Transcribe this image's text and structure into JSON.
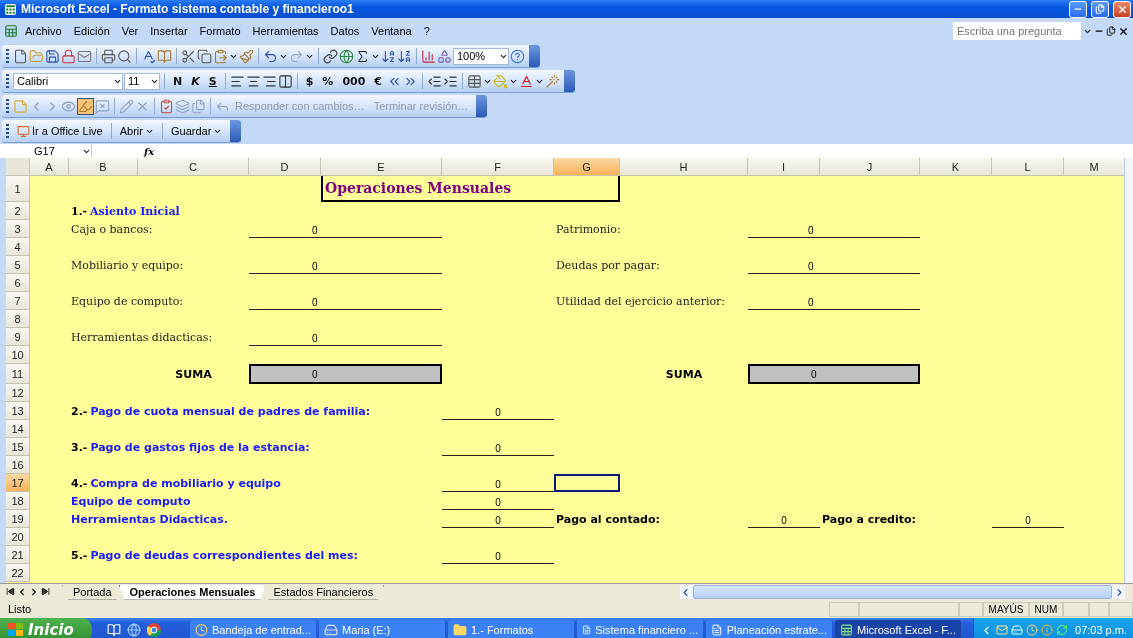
{
  "window": {
    "title": "Microsoft Excel - Formato sistema contable y financieroo1"
  },
  "menu": {
    "items": [
      "Archivo",
      "Edición",
      "Ver",
      "Insertar",
      "Formato",
      "Herramientas",
      "Datos",
      "Ventana",
      "?"
    ],
    "help_field": {
      "placeholder": "Escriba una pregunta"
    }
  },
  "standard_toolbar": {
    "zoom": "100%"
  },
  "format_toolbar": {
    "font": "Calibri",
    "size": "11",
    "style_buttons": [
      "N",
      "K",
      "S"
    ],
    "number_buttons": [
      "$",
      "%",
      "000",
      "€"
    ]
  },
  "review_toolbar": {
    "items": [
      {
        "label": "Responder con cambios…",
        "disabled": true
      },
      {
        "label": "Terminar revisión…",
        "disabled": true
      }
    ]
  },
  "office_live_toolbar": {
    "buttons": [
      {
        "label": "Ir a Office Live",
        "dropdown": false
      },
      {
        "label": "Abrir",
        "dropdown": true
      },
      {
        "label": "Guardar",
        "dropdown": true
      }
    ]
  },
  "formula_bar": {
    "name_box": "G17",
    "function_label": "fx"
  },
  "columns": [
    {
      "label": "A",
      "selected": false
    },
    {
      "label": "B",
      "selected": false
    },
    {
      "label": "C",
      "selected": false
    },
    {
      "label": "D",
      "selected": false
    },
    {
      "label": "E",
      "selected": false
    },
    {
      "label": "F",
      "selected": false
    },
    {
      "label": "G",
      "selected": true
    },
    {
      "label": "H",
      "selected": false
    },
    {
      "label": "I",
      "selected": false
    },
    {
      "label": "J",
      "selected": false
    },
    {
      "label": "K",
      "selected": false
    },
    {
      "label": "L",
      "selected": false
    },
    {
      "label": "M",
      "selected": false
    }
  ],
  "rows": [
    {
      "number": "1",
      "selected": false,
      "cells": [
        {
          "kind": "title",
          "text": "Operaciones Mensuales"
        }
      ]
    },
    {
      "number": "2",
      "selected": false,
      "cells": [
        {
          "kind": "serif-section",
          "prefix": "1.-",
          "text": "Asiento Inicial"
        }
      ]
    },
    {
      "number": "3",
      "selected": false,
      "cells": [
        {
          "kind": "label",
          "text": "Caja o bancos:"
        },
        {
          "kind": "amount",
          "text": "0"
        },
        {
          "kind": "right-label",
          "text": "Patrimonio:"
        },
        {
          "kind": "right-amount",
          "text": "0"
        }
      ]
    },
    {
      "number": "4",
      "selected": false
    },
    {
      "number": "5",
      "selected": false,
      "cells": [
        {
          "kind": "label",
          "text": "Mobiliario y equipo:"
        },
        {
          "kind": "amount",
          "text": "0"
        },
        {
          "kind": "right-label",
          "text": "Deudas por pagar:"
        },
        {
          "kind": "right-amount",
          "text": "0"
        }
      ]
    },
    {
      "number": "6",
      "selected": false
    },
    {
      "number": "7",
      "selected": false,
      "cells": [
        {
          "kind": "label",
          "text": "Equipo de computo:"
        },
        {
          "kind": "amount",
          "text": "0"
        },
        {
          "kind": "right-label",
          "text": "Utilidad del ejercicio anterior:"
        },
        {
          "kind": "right-amount",
          "text": "0"
        }
      ]
    },
    {
      "number": "8",
      "selected": false
    },
    {
      "number": "9",
      "selected": false,
      "cells": [
        {
          "kind": "label",
          "text": "Herramientas didacticas:"
        },
        {
          "kind": "amount",
          "text": "0"
        }
      ]
    },
    {
      "number": "10",
      "selected": false
    },
    {
      "number": "11",
      "selected": false,
      "cells": [
        {
          "kind": "sum-label",
          "text": "SUMA"
        },
        {
          "kind": "sum-amount",
          "text": "0"
        },
        {
          "kind": "right-sum-label",
          "text": "SUMA"
        },
        {
          "kind": "right-sum-amount",
          "text": "0"
        }
      ]
    },
    {
      "number": "12",
      "selected": false
    },
    {
      "number": "13",
      "selected": false,
      "cells": [
        {
          "kind": "section",
          "prefix": "2.-",
          "text": "Pago de cuota mensual de padres de familia:"
        },
        {
          "kind": "f-amount",
          "text": "0"
        }
      ]
    },
    {
      "number": "14",
      "selected": false
    },
    {
      "number": "15",
      "selected": false,
      "cells": [
        {
          "kind": "section",
          "prefix": "3.-",
          "text": "Pago de gastos fijos de la estancia:"
        },
        {
          "kind": "f-amount",
          "text": "0"
        }
      ]
    },
    {
      "number": "16",
      "selected": false
    },
    {
      "number": "17",
      "selected": true,
      "cells": [
        {
          "kind": "section",
          "prefix": "4.-",
          "text": "Compra de mobiliario y equipo"
        },
        {
          "kind": "f-amount",
          "text": "0"
        }
      ]
    },
    {
      "number": "18",
      "selected": false,
      "cells": [
        {
          "kind": "subheading",
          "text": "Equipo de computo"
        },
        {
          "kind": "f-amount",
          "text": "0"
        }
      ]
    },
    {
      "number": "19",
      "selected": false,
      "cells": [
        {
          "kind": "subheading",
          "text": "Herramientas Didacticas."
        },
        {
          "kind": "f-amount",
          "text": "0"
        },
        {
          "kind": "g-label",
          "text": "Pago al contado:"
        },
        {
          "kind": "i-amount",
          "text": "0"
        },
        {
          "kind": "j-label",
          "text": "Pago a credito:"
        },
        {
          "kind": "l-amount",
          "text": "0"
        }
      ]
    },
    {
      "number": "20",
      "selected": false
    },
    {
      "number": "21",
      "selected": false,
      "cells": [
        {
          "kind": "section",
          "prefix": "5.-",
          "text": "Pago de deudas correspondientes del mes:"
        },
        {
          "kind": "f-amount",
          "text": "0"
        }
      ]
    },
    {
      "number": "22",
      "selected": false
    }
  ],
  "sheet_tabs": [
    {
      "label": "Portada",
      "selected": false
    },
    {
      "label": "Operaciones Mensuales",
      "selected": true
    },
    {
      "label": "Estados Financieros",
      "selected": false
    }
  ],
  "status_bar": {
    "status": "Listo",
    "indicators": [
      "MAYÚS",
      "NUM"
    ]
  },
  "taskbar": {
    "start": "Inicio",
    "tasks": [
      {
        "kind": "clock",
        "label": "Bandeja de entrad...",
        "selected": false
      },
      {
        "kind": "drive",
        "label": "Maria (E:)",
        "selected": false
      },
      {
        "kind": "folder",
        "label": "1.- Formatos",
        "selected": false
      },
      {
        "kind": "document",
        "label": "Sistema financiero ...",
        "selected": false
      },
      {
        "kind": "document",
        "label": "Planeación estrate...",
        "selected": false
      },
      {
        "kind": "spreadsheet",
        "label": "Microsoft Excel - F...",
        "selected": true
      }
    ],
    "clock": "07:03 p.m."
  }
}
